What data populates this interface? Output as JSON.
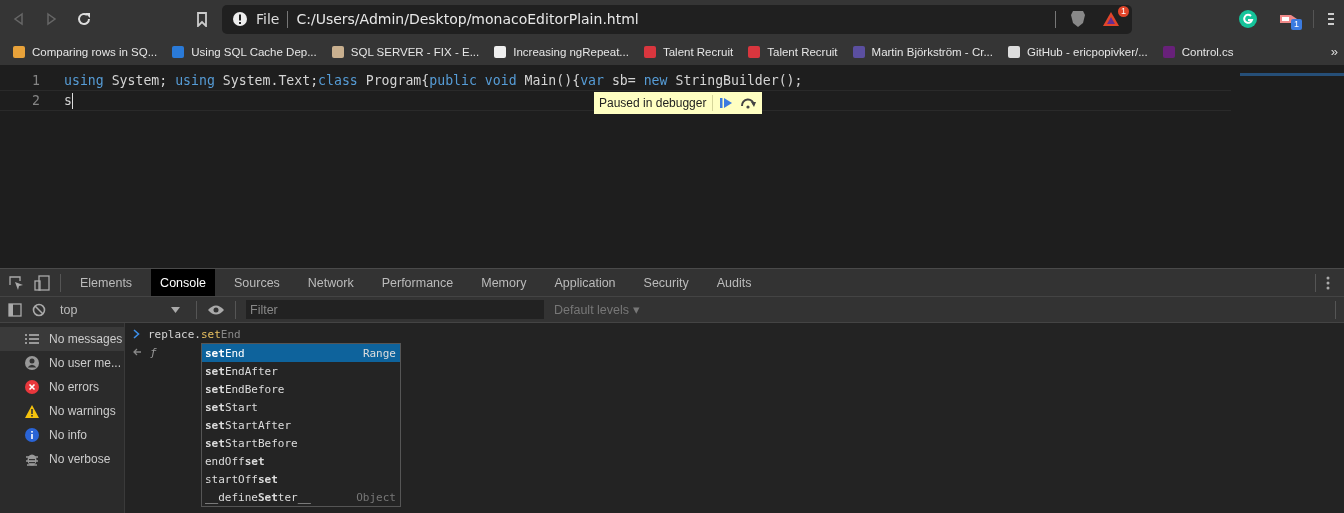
{
  "address_bar": {
    "scheme": "File",
    "url": "C:/Users/Admin/Desktop/monacoEditorPlain.html",
    "rewards_badge": "1"
  },
  "extension_badge": "1",
  "bookmarks": [
    "Comparing rows in SQ...",
    "Using SQL Cache Dep...",
    "SQL SERVER - FIX - E...",
    "Increasing ngRepeat...",
    "Talent Recruit",
    "Talent Recruit",
    "Martin Björkström - Cr...",
    "GitHub - ericpopivker/...",
    "Control.cs"
  ],
  "bookmarks_overflow": "»",
  "editor": {
    "lines": [
      {
        "number": "1",
        "tokens": [
          {
            "text": "using",
            "kind": "keyword"
          },
          {
            "text": " System; ",
            "kind": "plain"
          },
          {
            "text": "using",
            "kind": "keyword"
          },
          {
            "text": " System.Text;",
            "kind": "plain"
          },
          {
            "text": "class",
            "kind": "keyword"
          },
          {
            "text": " Program{",
            "kind": "plain"
          },
          {
            "text": "public void",
            "kind": "keyword"
          },
          {
            "text": " Main(){",
            "kind": "plain"
          },
          {
            "text": "var",
            "kind": "keyword"
          },
          {
            "text": " sb= ",
            "kind": "plain"
          },
          {
            "text": "new",
            "kind": "keyword"
          },
          {
            "text": " StringBuilder();",
            "kind": "plain"
          }
        ]
      },
      {
        "number": "2",
        "tokens": [
          {
            "text": "s",
            "kind": "plain"
          }
        ]
      }
    ]
  },
  "debugger_banner": {
    "text": "Paused in debugger"
  },
  "devtools": {
    "tabs": [
      {
        "label": "Elements",
        "selected": false
      },
      {
        "label": "Console",
        "selected": true
      },
      {
        "label": "Sources",
        "selected": false
      },
      {
        "label": "Network",
        "selected": false
      },
      {
        "label": "Performance",
        "selected": false
      },
      {
        "label": "Memory",
        "selected": false
      },
      {
        "label": "Application",
        "selected": false
      },
      {
        "label": "Security",
        "selected": false
      },
      {
        "label": "Audits",
        "selected": false
      }
    ],
    "context": "top",
    "filter": {
      "placeholder": "Filter"
    },
    "levels": "Default levels ▾",
    "sidebar": [
      {
        "label": "No messages",
        "kind": "messages",
        "selected": true
      },
      {
        "label": "No user me...",
        "kind": "user",
        "selected": false
      },
      {
        "label": "No errors",
        "kind": "error",
        "selected": false
      },
      {
        "label": "No warnings",
        "kind": "warning",
        "selected": false
      },
      {
        "label": "No info",
        "kind": "info",
        "selected": false
      },
      {
        "label": "No verbose",
        "kind": "verbose",
        "selected": false
      }
    ],
    "input": {
      "object": "replace.",
      "match": "set",
      "rest": "End"
    },
    "result": "ƒ",
    "suggestions": [
      {
        "text": "**set**End",
        "type": "Range",
        "selected": true
      },
      {
        "text": "**set**EndAfter",
        "selected": false
      },
      {
        "text": "**set**EndBefore",
        "selected": false
      },
      {
        "text": "**set**Start",
        "selected": false
      },
      {
        "text": "**set**StartAfter",
        "selected": false
      },
      {
        "text": "**set**StartBefore",
        "selected": false
      },
      {
        "text": "endOff**set**",
        "selected": false
      },
      {
        "text": "startOff**set**",
        "selected": false
      },
      {
        "text": "__define**Set**ter__",
        "type": "Object",
        "selected": false
      }
    ]
  }
}
